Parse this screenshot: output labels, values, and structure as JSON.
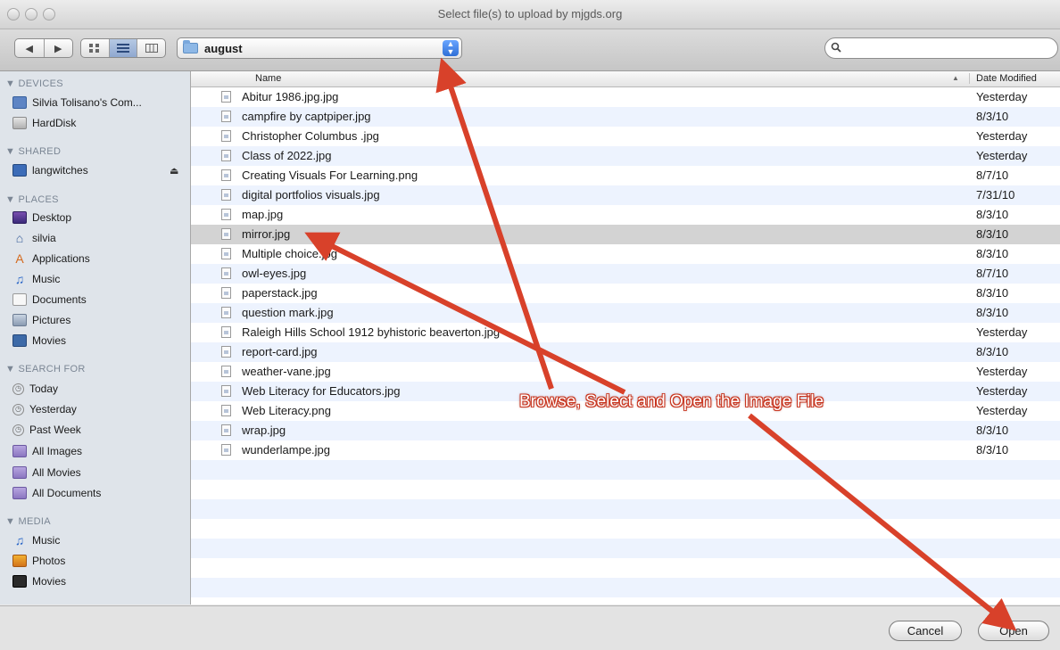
{
  "window": {
    "title": "Select file(s) to upload by mjgds.org"
  },
  "toolbar": {
    "folder": "august",
    "back_glyph": "◀",
    "forward_glyph": "▶",
    "search_placeholder": "",
    "search_value": ""
  },
  "sidebar": {
    "sections": [
      {
        "header": "▼ DEVICES",
        "items": [
          {
            "label": "Silvia Tolisano's Com...",
            "icon": "laptop-icon"
          },
          {
            "label": "HardDisk",
            "icon": "harddisk-icon"
          }
        ]
      },
      {
        "header": "▼ SHARED",
        "items": [
          {
            "label": "langwitches",
            "icon": "network-computer-icon",
            "eject": "⏏"
          }
        ]
      },
      {
        "header": "▼ PLACES",
        "items": [
          {
            "label": "Desktop",
            "icon": "desktop-icon"
          },
          {
            "label": "silvia",
            "icon": "home-icon"
          },
          {
            "label": "Applications",
            "icon": "applications-icon"
          },
          {
            "label": "Music",
            "icon": "music-icon"
          },
          {
            "label": "Documents",
            "icon": "documents-icon"
          },
          {
            "label": "Pictures",
            "icon": "pictures-icon"
          },
          {
            "label": "Movies",
            "icon": "movies-icon"
          }
        ]
      },
      {
        "header": "▼ SEARCH FOR",
        "items": [
          {
            "label": "Today",
            "icon": "clock-icon"
          },
          {
            "label": "Yesterday",
            "icon": "clock-icon"
          },
          {
            "label": "Past Week",
            "icon": "clock-icon"
          },
          {
            "label": "All Images",
            "icon": "smart-folder-icon"
          },
          {
            "label": "All Movies",
            "icon": "smart-folder-icon"
          },
          {
            "label": "All Documents",
            "icon": "smart-folder-icon"
          }
        ]
      },
      {
        "header": "▼ MEDIA",
        "items": [
          {
            "label": "Music",
            "icon": "music-icon"
          },
          {
            "label": "Photos",
            "icon": "photos-icon"
          },
          {
            "label": "Movies",
            "icon": "movies-icon"
          }
        ]
      }
    ]
  },
  "list": {
    "columns": {
      "name": "Name",
      "date": "Date Modified",
      "sort_glyph": "▲"
    },
    "files": [
      {
        "name": "Abitur 1986.jpg.jpg",
        "date": "Yesterday"
      },
      {
        "name": "campfire by captpiper.jpg",
        "date": "8/3/10"
      },
      {
        "name": "Christopher Columbus .jpg",
        "date": "Yesterday"
      },
      {
        "name": "Class of 2022.jpg",
        "date": "Yesterday"
      },
      {
        "name": "Creating Visuals For Learning.png",
        "date": "8/7/10"
      },
      {
        "name": "digital portfolios visuals.jpg",
        "date": "7/31/10"
      },
      {
        "name": "map.jpg",
        "date": "8/3/10"
      },
      {
        "name": "mirror.jpg",
        "date": "8/3/10",
        "selected": true
      },
      {
        "name": "Multiple choice.jpg",
        "date": "8/3/10"
      },
      {
        "name": "owl-eyes.jpg",
        "date": "8/7/10"
      },
      {
        "name": "paperstack.jpg",
        "date": "8/3/10"
      },
      {
        "name": "question mark.jpg",
        "date": "8/3/10"
      },
      {
        "name": "Raleigh Hills School 1912 byhistoric beaverton.jpg",
        "date": "Yesterday"
      },
      {
        "name": "report-card.jpg",
        "date": "8/3/10"
      },
      {
        "name": "weather-vane.jpg",
        "date": "Yesterday"
      },
      {
        "name": "Web Literacy for Educators.jpg",
        "date": "Yesterday"
      },
      {
        "name": "Web Literacy.png",
        "date": "Yesterday"
      },
      {
        "name": "wrap.jpg",
        "date": "8/3/10"
      },
      {
        "name": "wunderlampe.jpg",
        "date": "8/3/10"
      }
    ]
  },
  "buttons": {
    "cancel": "Cancel",
    "open": "Open"
  },
  "annotation": {
    "callout": "Browse, Select and Open the Image File",
    "arrow_color": "#d8412a"
  }
}
